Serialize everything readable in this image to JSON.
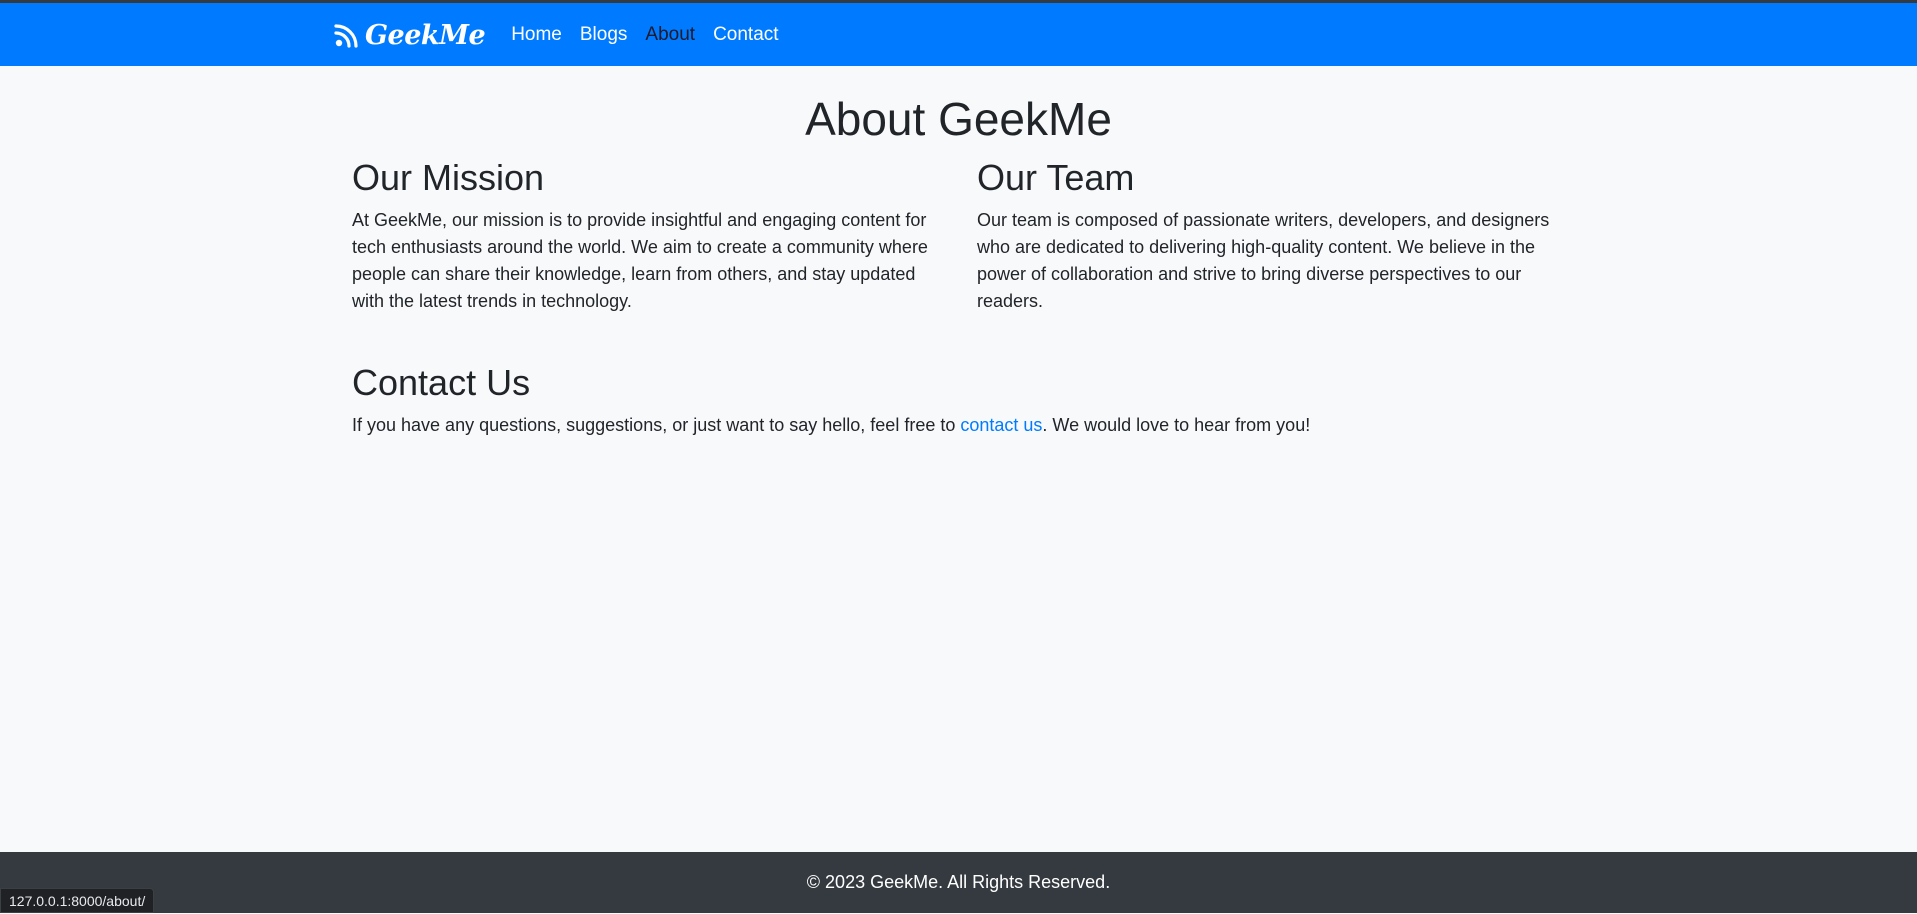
{
  "nav": {
    "brand": "GeekMe",
    "brand_icon": "rss-feed-icon",
    "links": [
      {
        "label": "Home"
      },
      {
        "label": "Blogs"
      },
      {
        "label": "About",
        "active": true
      },
      {
        "label": "Contact"
      }
    ]
  },
  "page": {
    "title": "About GeekMe",
    "mission": {
      "heading": "Our Mission",
      "text": "At GeekMe, our mission is to provide insightful and engaging content for tech enthusiasts around the world. We aim to create a community where people can share their knowledge, learn from others, and stay updated with the latest trends in technology."
    },
    "team": {
      "heading": "Our Team",
      "text": "Our team is composed of passionate writers, developers, and designers who are dedicated to delivering high-quality content. We believe in the power of collaboration and strive to bring diverse perspectives to our readers."
    },
    "contact": {
      "heading": "Contact Us",
      "text_before": "If you have any questions, suggestions, or just want to say hello, feel free to ",
      "link_label": "contact us",
      "text_after": ". We would love to hear from you!"
    }
  },
  "footer": {
    "text": "© 2023 GeekMe. All Rights Reserved."
  },
  "status_bar": {
    "url": "127.0.0.1:8000/about/"
  },
  "colors": {
    "navbar": "#007bff",
    "footer": "#343a40",
    "background": "#f8f9fa",
    "link": "#007bff"
  }
}
